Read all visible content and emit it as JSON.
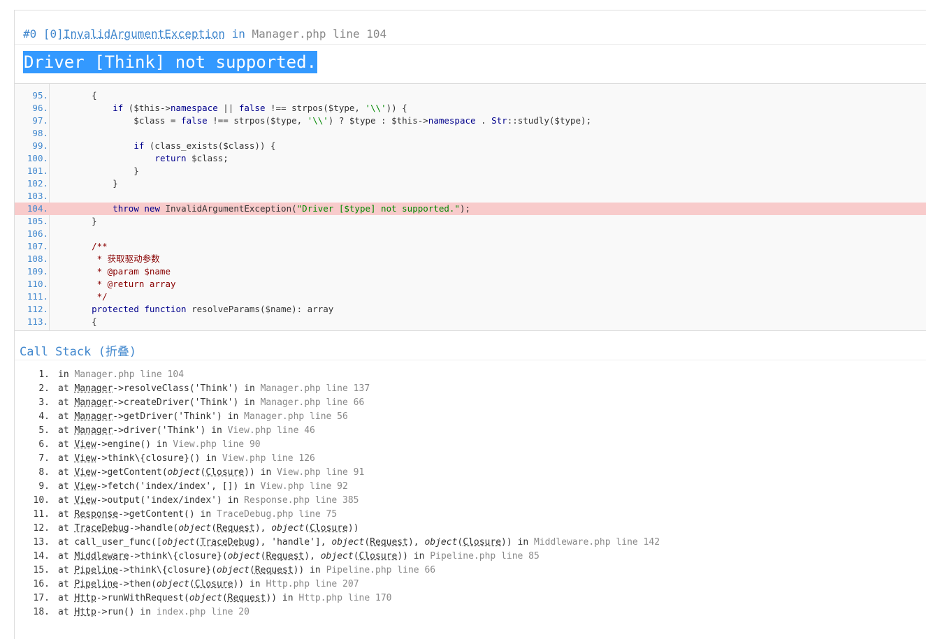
{
  "exception": {
    "prefix": "#0 [0]",
    "class_name": "InvalidArgumentException",
    "in_word": " in ",
    "file": "Manager.php line 104",
    "message": "Driver [Think] not supported."
  },
  "source": {
    "highlight_line": 104,
    "lines": [
      {
        "n": "95.",
        "tokens": [
          {
            "t": "    {",
            "c": ""
          }
        ]
      },
      {
        "n": "96.",
        "tokens": [
          {
            "t": "        ",
            "c": ""
          },
          {
            "t": "if",
            "c": "kw"
          },
          {
            "t": " ($this->",
            "c": ""
          },
          {
            "t": "namespace",
            "c": "kw"
          },
          {
            "t": " || ",
            "c": ""
          },
          {
            "t": "false",
            "c": "kw"
          },
          {
            "t": " !== strpos($type, ",
            "c": ""
          },
          {
            "t": "'\\\\'",
            "c": "str"
          },
          {
            "t": ")) {",
            "c": ""
          }
        ]
      },
      {
        "n": "97.",
        "tokens": [
          {
            "t": "            $class = ",
            "c": ""
          },
          {
            "t": "false",
            "c": "kw"
          },
          {
            "t": " !== strpos($type, ",
            "c": ""
          },
          {
            "t": "'\\\\'",
            "c": "str"
          },
          {
            "t": ") ? $type : $this->",
            "c": ""
          },
          {
            "t": "namespace",
            "c": "kw"
          },
          {
            "t": " . ",
            "c": ""
          },
          {
            "t": "Str",
            "c": "kw"
          },
          {
            "t": "::studly($type);",
            "c": ""
          }
        ]
      },
      {
        "n": "98.",
        "tokens": [
          {
            "t": "",
            "c": ""
          }
        ]
      },
      {
        "n": "99.",
        "tokens": [
          {
            "t": "            ",
            "c": ""
          },
          {
            "t": "if",
            "c": "kw"
          },
          {
            "t": " (class_exists($class)) {",
            "c": ""
          }
        ]
      },
      {
        "n": "100.",
        "tokens": [
          {
            "t": "                ",
            "c": ""
          },
          {
            "t": "return",
            "c": "kw"
          },
          {
            "t": " $class;",
            "c": ""
          }
        ]
      },
      {
        "n": "101.",
        "tokens": [
          {
            "t": "            }",
            "c": ""
          }
        ]
      },
      {
        "n": "102.",
        "tokens": [
          {
            "t": "        }",
            "c": ""
          }
        ]
      },
      {
        "n": "103.",
        "tokens": [
          {
            "t": "",
            "c": ""
          }
        ]
      },
      {
        "n": "104.",
        "tokens": [
          {
            "t": "        ",
            "c": ""
          },
          {
            "t": "throw",
            "c": "kw"
          },
          {
            "t": " ",
            "c": ""
          },
          {
            "t": "new",
            "c": "kw"
          },
          {
            "t": " InvalidArgumentException(",
            "c": ""
          },
          {
            "t": "\"Driver [$type] not supported.\"",
            "c": "str"
          },
          {
            "t": ");",
            "c": ""
          }
        ]
      },
      {
        "n": "105.",
        "tokens": [
          {
            "t": "    }",
            "c": ""
          }
        ]
      },
      {
        "n": "106.",
        "tokens": [
          {
            "t": "",
            "c": ""
          }
        ]
      },
      {
        "n": "107.",
        "tokens": [
          {
            "t": "    /**",
            "c": "cm"
          }
        ]
      },
      {
        "n": "108.",
        "tokens": [
          {
            "t": "     * 获取驱动参数",
            "c": "cm"
          }
        ]
      },
      {
        "n": "109.",
        "tokens": [
          {
            "t": "     * @param $name",
            "c": "cm"
          }
        ]
      },
      {
        "n": "110.",
        "tokens": [
          {
            "t": "     * @return array",
            "c": "cm"
          }
        ]
      },
      {
        "n": "111.",
        "tokens": [
          {
            "t": "     */",
            "c": "cm"
          }
        ]
      },
      {
        "n": "112.",
        "tokens": [
          {
            "t": "    ",
            "c": ""
          },
          {
            "t": "protected",
            "c": "kw"
          },
          {
            "t": " ",
            "c": ""
          },
          {
            "t": "function",
            "c": "kw"
          },
          {
            "t": " resolveParams($name): array",
            "c": ""
          }
        ]
      },
      {
        "n": "113.",
        "tokens": [
          {
            "t": "    {",
            "c": ""
          }
        ]
      }
    ]
  },
  "call_stack": {
    "title": "Call Stack (折叠)",
    "rows": [
      {
        "n": "1.",
        "parts": [
          {
            "t": "in ",
            "c": ""
          },
          {
            "t": "Manager.php line 104",
            "c": "gray"
          }
        ]
      },
      {
        "n": "2.",
        "parts": [
          {
            "t": "at ",
            "c": ""
          },
          {
            "t": "Manager",
            "c": "ab"
          },
          {
            "t": "->resolveClass('Think') in ",
            "c": ""
          },
          {
            "t": "Manager.php line 137",
            "c": "gray"
          }
        ]
      },
      {
        "n": "3.",
        "parts": [
          {
            "t": "at ",
            "c": ""
          },
          {
            "t": "Manager",
            "c": "ab"
          },
          {
            "t": "->createDriver('Think') in ",
            "c": ""
          },
          {
            "t": "Manager.php line 66",
            "c": "gray"
          }
        ]
      },
      {
        "n": "4.",
        "parts": [
          {
            "t": "at ",
            "c": ""
          },
          {
            "t": "Manager",
            "c": "ab"
          },
          {
            "t": "->getDriver('Think') in ",
            "c": ""
          },
          {
            "t": "Manager.php line 56",
            "c": "gray"
          }
        ]
      },
      {
        "n": "5.",
        "parts": [
          {
            "t": "at ",
            "c": ""
          },
          {
            "t": "Manager",
            "c": "ab"
          },
          {
            "t": "->driver('Think') in ",
            "c": ""
          },
          {
            "t": "View.php line 46",
            "c": "gray"
          }
        ]
      },
      {
        "n": "6.",
        "parts": [
          {
            "t": "at ",
            "c": ""
          },
          {
            "t": "View",
            "c": "ab"
          },
          {
            "t": "->engine() in ",
            "c": ""
          },
          {
            "t": "View.php line 90",
            "c": "gray"
          }
        ]
      },
      {
        "n": "7.",
        "parts": [
          {
            "t": "at ",
            "c": ""
          },
          {
            "t": "View",
            "c": "ab"
          },
          {
            "t": "->think\\{closure}() in ",
            "c": ""
          },
          {
            "t": "View.php line 126",
            "c": "gray"
          }
        ]
      },
      {
        "n": "8.",
        "parts": [
          {
            "t": "at ",
            "c": ""
          },
          {
            "t": "View",
            "c": "ab"
          },
          {
            "t": "->getContent(",
            "c": ""
          },
          {
            "t": "object",
            "c": "it"
          },
          {
            "t": "(",
            "c": ""
          },
          {
            "t": "Closure",
            "c": "ab"
          },
          {
            "t": ")) in ",
            "c": ""
          },
          {
            "t": "View.php line 91",
            "c": "gray"
          }
        ]
      },
      {
        "n": "9.",
        "parts": [
          {
            "t": "at ",
            "c": ""
          },
          {
            "t": "View",
            "c": "ab"
          },
          {
            "t": "->fetch('index/index', []) in ",
            "c": ""
          },
          {
            "t": "View.php line 92",
            "c": "gray"
          }
        ]
      },
      {
        "n": "10.",
        "parts": [
          {
            "t": "at ",
            "c": ""
          },
          {
            "t": "View",
            "c": "ab"
          },
          {
            "t": "->output('index/index') in ",
            "c": ""
          },
          {
            "t": "Response.php line 385",
            "c": "gray"
          }
        ]
      },
      {
        "n": "11.",
        "parts": [
          {
            "t": "at ",
            "c": ""
          },
          {
            "t": "Response",
            "c": "ab"
          },
          {
            "t": "->getContent() in ",
            "c": ""
          },
          {
            "t": "TraceDebug.php line 75",
            "c": "gray"
          }
        ]
      },
      {
        "n": "12.",
        "parts": [
          {
            "t": "at ",
            "c": ""
          },
          {
            "t": "TraceDebug",
            "c": "ab"
          },
          {
            "t": "->handle(",
            "c": ""
          },
          {
            "t": "object",
            "c": "it"
          },
          {
            "t": "(",
            "c": ""
          },
          {
            "t": "Request",
            "c": "ab"
          },
          {
            "t": "), ",
            "c": ""
          },
          {
            "t": "object",
            "c": "it"
          },
          {
            "t": "(",
            "c": ""
          },
          {
            "t": "Closure",
            "c": "ab"
          },
          {
            "t": "))",
            "c": ""
          }
        ]
      },
      {
        "n": "13.",
        "parts": [
          {
            "t": "at call_user_func([",
            "c": ""
          },
          {
            "t": "object",
            "c": "it"
          },
          {
            "t": "(",
            "c": ""
          },
          {
            "t": "TraceDebug",
            "c": "ab"
          },
          {
            "t": "), 'handle'], ",
            "c": ""
          },
          {
            "t": "object",
            "c": "it"
          },
          {
            "t": "(",
            "c": ""
          },
          {
            "t": "Request",
            "c": "ab"
          },
          {
            "t": "), ",
            "c": ""
          },
          {
            "t": "object",
            "c": "it"
          },
          {
            "t": "(",
            "c": ""
          },
          {
            "t": "Closure",
            "c": "ab"
          },
          {
            "t": ")) in ",
            "c": ""
          },
          {
            "t": "Middleware.php line 142",
            "c": "gray"
          }
        ]
      },
      {
        "n": "14.",
        "parts": [
          {
            "t": "at ",
            "c": ""
          },
          {
            "t": "Middleware",
            "c": "ab"
          },
          {
            "t": "->think\\{closure}(",
            "c": ""
          },
          {
            "t": "object",
            "c": "it"
          },
          {
            "t": "(",
            "c": ""
          },
          {
            "t": "Request",
            "c": "ab"
          },
          {
            "t": "), ",
            "c": ""
          },
          {
            "t": "object",
            "c": "it"
          },
          {
            "t": "(",
            "c": ""
          },
          {
            "t": "Closure",
            "c": "ab"
          },
          {
            "t": ")) in ",
            "c": ""
          },
          {
            "t": "Pipeline.php line 85",
            "c": "gray"
          }
        ]
      },
      {
        "n": "15.",
        "parts": [
          {
            "t": "at ",
            "c": ""
          },
          {
            "t": "Pipeline",
            "c": "ab"
          },
          {
            "t": "->think\\{closure}(",
            "c": ""
          },
          {
            "t": "object",
            "c": "it"
          },
          {
            "t": "(",
            "c": ""
          },
          {
            "t": "Request",
            "c": "ab"
          },
          {
            "t": ")) in ",
            "c": ""
          },
          {
            "t": "Pipeline.php line 66",
            "c": "gray"
          }
        ]
      },
      {
        "n": "16.",
        "parts": [
          {
            "t": "at ",
            "c": ""
          },
          {
            "t": "Pipeline",
            "c": "ab"
          },
          {
            "t": "->then(",
            "c": ""
          },
          {
            "t": "object",
            "c": "it"
          },
          {
            "t": "(",
            "c": ""
          },
          {
            "t": "Closure",
            "c": "ab"
          },
          {
            "t": ")) in ",
            "c": ""
          },
          {
            "t": "Http.php line 207",
            "c": "gray"
          }
        ]
      },
      {
        "n": "17.",
        "parts": [
          {
            "t": "at ",
            "c": ""
          },
          {
            "t": "Http",
            "c": "ab"
          },
          {
            "t": "->runWithRequest(",
            "c": ""
          },
          {
            "t": "object",
            "c": "it"
          },
          {
            "t": "(",
            "c": ""
          },
          {
            "t": "Request",
            "c": "ab"
          },
          {
            "t": ")) in ",
            "c": ""
          },
          {
            "t": "Http.php line 170",
            "c": "gray"
          }
        ]
      },
      {
        "n": "18.",
        "parts": [
          {
            "t": "at ",
            "c": ""
          },
          {
            "t": "Http",
            "c": "ab"
          },
          {
            "t": "->run() in ",
            "c": ""
          },
          {
            "t": "index.php line 20",
            "c": "gray"
          }
        ]
      }
    ]
  },
  "colors": {
    "link": "#4288ce",
    "muted": "#888888",
    "highlight_line": "#f8cbcb",
    "selection": "#3399ff"
  }
}
